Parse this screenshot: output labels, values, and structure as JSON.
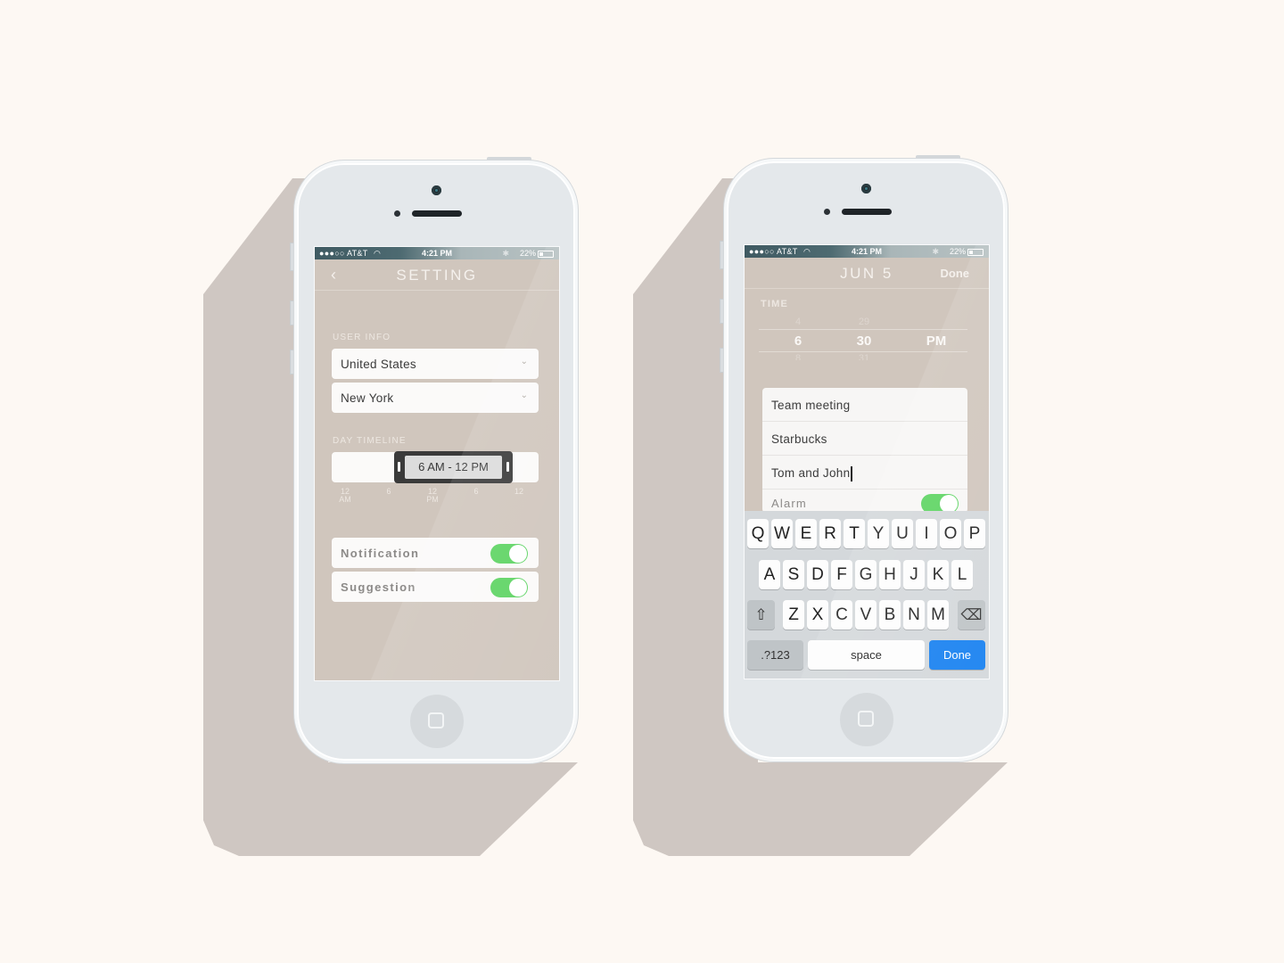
{
  "phone_left": {
    "status_bar": {
      "carrier": "●●●○○ AT&T",
      "wifi": "wifi-icon",
      "time": "4:21 PM",
      "bluetooth": "✱",
      "battery": "22%"
    },
    "nav": {
      "back_icon": "‹",
      "title": "SETTING"
    },
    "user_info": {
      "label": "USER INFO",
      "country": {
        "value": "United States",
        "chevron": "⌄"
      },
      "city": {
        "value": "New York",
        "chevron": "⌄"
      }
    },
    "day_timeline": {
      "label": "DAY TIMELINE",
      "range_text": "6 AM  -  12 PM",
      "range_start_hour": 6,
      "range_end_hour": 12,
      "ticks": [
        {
          "top": "12",
          "bottom": "AM"
        },
        {
          "top": "6",
          "bottom": ""
        },
        {
          "top": "12",
          "bottom": "PM"
        },
        {
          "top": "6",
          "bottom": ""
        },
        {
          "top": "12",
          "bottom": ""
        }
      ]
    },
    "toggles": [
      {
        "label": "Notification",
        "on": true
      },
      {
        "label": "Suggestion",
        "on": true
      }
    ]
  },
  "phone_right": {
    "status_bar": {
      "carrier": "●●●○○ AT&T",
      "wifi": "wifi-icon",
      "time": "4:21 PM",
      "bluetooth": "✱",
      "battery": "22%"
    },
    "nav": {
      "title": "JUN 5",
      "done": "Done"
    },
    "time_picker": {
      "label": "TIME",
      "hour": {
        "above": "4",
        "selected": "6",
        "below": "8"
      },
      "minute": {
        "above": "29",
        "selected": "30",
        "below": "31"
      },
      "period": {
        "selected": "PM"
      }
    },
    "event": {
      "rows": [
        "Team meeting",
        "Starbucks",
        "Tom and John"
      ],
      "alarm_label": "Alarm",
      "alarm_on": true
    },
    "keyboard": {
      "row1": [
        "Q",
        "W",
        "E",
        "R",
        "T",
        "Y",
        "U",
        "I",
        "O",
        "P"
      ],
      "row2": [
        "A",
        "S",
        "D",
        "F",
        "G",
        "H",
        "J",
        "K",
        "L"
      ],
      "row3": [
        "Z",
        "X",
        "C",
        "V",
        "B",
        "N",
        "M"
      ],
      "shift": "⇧",
      "delete": "⌫",
      "numbers": ".?123",
      "space": "space",
      "done": "Done"
    }
  }
}
